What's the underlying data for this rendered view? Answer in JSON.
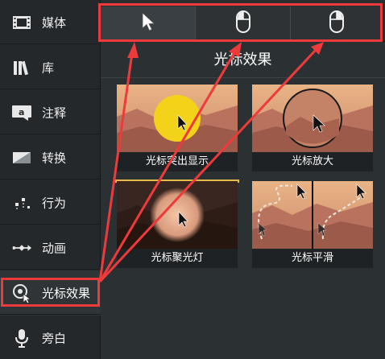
{
  "sidebar": {
    "items": [
      {
        "label": "媒体",
        "icon": "film-icon"
      },
      {
        "label": "库",
        "icon": "library-icon"
      },
      {
        "label": "注释",
        "icon": "annotation-icon"
      },
      {
        "label": "转换",
        "icon": "transition-icon"
      },
      {
        "label": "行为",
        "icon": "behavior-icon"
      },
      {
        "label": "动画",
        "icon": "animation-icon"
      },
      {
        "label": "光标效果",
        "icon": "cursor-effect-icon"
      },
      {
        "label": "旁白",
        "icon": "microphone-icon"
      }
    ],
    "active_index": 6
  },
  "toolbar": {
    "tabs": [
      {
        "icon": "pointer-icon"
      },
      {
        "icon": "left-click-mouse-icon"
      },
      {
        "icon": "right-click-mouse-icon"
      }
    ]
  },
  "panel": {
    "title": "光标效果",
    "effects": [
      {
        "label": "光标突出显示"
      },
      {
        "label": "光标放大"
      },
      {
        "label": "光标聚光灯",
        "selected": true
      },
      {
        "label": "光标平滑"
      }
    ]
  },
  "colors": {
    "annotation": "#ee3a3a",
    "selection": "#e6b94a",
    "highlight": "#f3d21a"
  }
}
